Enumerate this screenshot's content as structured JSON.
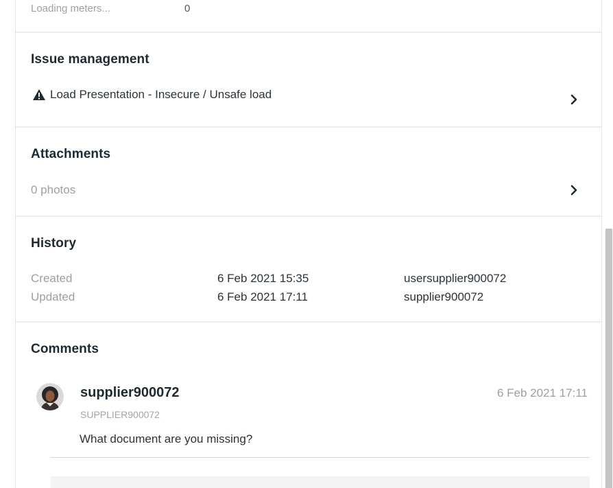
{
  "top_row": {
    "label": "Loading meters...",
    "value": "0"
  },
  "issue_management": {
    "title": "Issue management",
    "item": "Load Presentation - Insecure / Unsafe load",
    "icon": "warning-icon"
  },
  "attachments": {
    "title": "Attachments",
    "summary": "0 photos"
  },
  "history": {
    "title": "History",
    "rows": [
      {
        "label": "Created",
        "date": "6 Feb 2021 15:35",
        "user": "usersupplier900072"
      },
      {
        "label": "Updated",
        "date": "6 Feb 2021 17:11",
        "user": "supplier900072"
      }
    ]
  },
  "comments": {
    "title": "Comments",
    "items": [
      {
        "user": "supplier900072",
        "handle": "SUPPLIER900072",
        "time": "6 Feb 2021 17:11",
        "text": "What document are you missing?"
      }
    ]
  },
  "colors": {
    "heading": "#1e2a33",
    "muted": "#9aa0a6",
    "divider": "#ececec",
    "scrollbar": "#c4c4c4"
  }
}
